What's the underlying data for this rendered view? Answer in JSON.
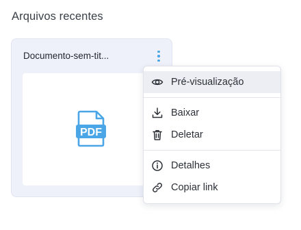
{
  "section": {
    "title": "Arquivos recentes"
  },
  "card": {
    "filename": "Documento-sem-tit...",
    "preview_icon": "pdf-file-icon",
    "preview_label": "PDF",
    "accent": "#4aa6e6"
  },
  "menu": {
    "groups": [
      [
        {
          "label": "Pré-visualização",
          "icon": "eye-icon",
          "highlighted": true
        }
      ],
      [
        {
          "label": "Baixar",
          "icon": "download-icon"
        },
        {
          "label": "Deletar",
          "icon": "trash-icon"
        }
      ],
      [
        {
          "label": "Detalhes",
          "icon": "info-icon"
        },
        {
          "label": "Copiar link",
          "icon": "link-icon"
        }
      ]
    ]
  }
}
